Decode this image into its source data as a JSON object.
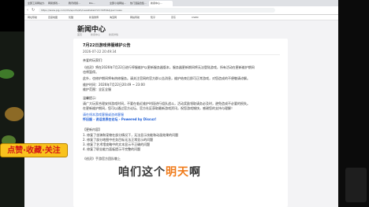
{
  "browser": {
    "tabs": [
      "全部工具网站分...",
      "网易游戏...",
      "腾讯视频...",
      "Dis...",
      "全部小说网站...",
      "热门漫画合集...",
      "新闻中心..."
    ],
    "url": "https://www.pig.com/dm/sports/zh/newsDetail?id=3455&type=news",
    "bookmarks": [
      "网址导航",
      "百度地图",
      "优酷",
      "新浪微博",
      "淘宝网",
      "网站导航",
      "知乎",
      "京东",
      "CSDN"
    ]
  },
  "page": {
    "title": "新闻中心",
    "breadcrumbs": [
      "首页",
      "新闻中心",
      "新闻详情"
    ],
    "article": {
      "title": "7月22日游戏停服维护公告",
      "date": "2026-07-22 20:49:34",
      "greeting": "亲爱的玩家们:",
      "paragraphs": [
        "《创灵》将在2026年7月22日进行停服维护以更新服务器版本，服务器更新期间将无法登陆游戏，所有活动在更新维护期间",
        "也将暂停。",
        "此外，也修护期间将有热修服务。请关注官网的官方群公告消息，维护结束后即可正常游戏，对您造成的不便敬请谅解。",
        "维护时间：2026年7月22日20:49 ~ 23:00",
        "维护范围：全区全服"
      ],
      "section_title": "温馨提示:",
      "notes": [
        "请广大玩家合理安排游戏时间，不要在临近维护时段进行组队战斗，活动奖励领取请务必及时，避免造成不必要的损失。",
        "在更新维护期间，您可以通过官方论坛、官方社区获取最新游戏资讯，祝您游戏愉快，感谢您的支持与理解！"
      ],
      "link": "请在线本游戏客服或咨询客服",
      "powered": "怀旧服 - 说话发表在论坛 - Powered by Discuz!",
      "changes_title": "【更新内容】",
      "changes": [
        "1. 修复了坐骑和宠物在部分情况下，无法显示技能和动画效果的问题",
        "2. 修复了部分地图中任务目标无法正常显示的问题",
        "3. 修复了艺术馆攻略中的文本显示不正确的问题",
        "4. 修复了职业能力面板提示不完整的问题"
      ],
      "signoff": "《创灵》手游官方团队敬上"
    }
  },
  "overlay": {
    "promo_text": "点赞·收藏·关注",
    "subtitle_before": "咱们这个",
    "subtitle_highlight": "明天",
    "subtitle_after": "啊"
  },
  "colors": {
    "accent_link": "#1a5bd6",
    "promo_bg": "#f9c21d",
    "promo_text": "#d31616",
    "subtitle_highlight": "#f07b1a"
  }
}
